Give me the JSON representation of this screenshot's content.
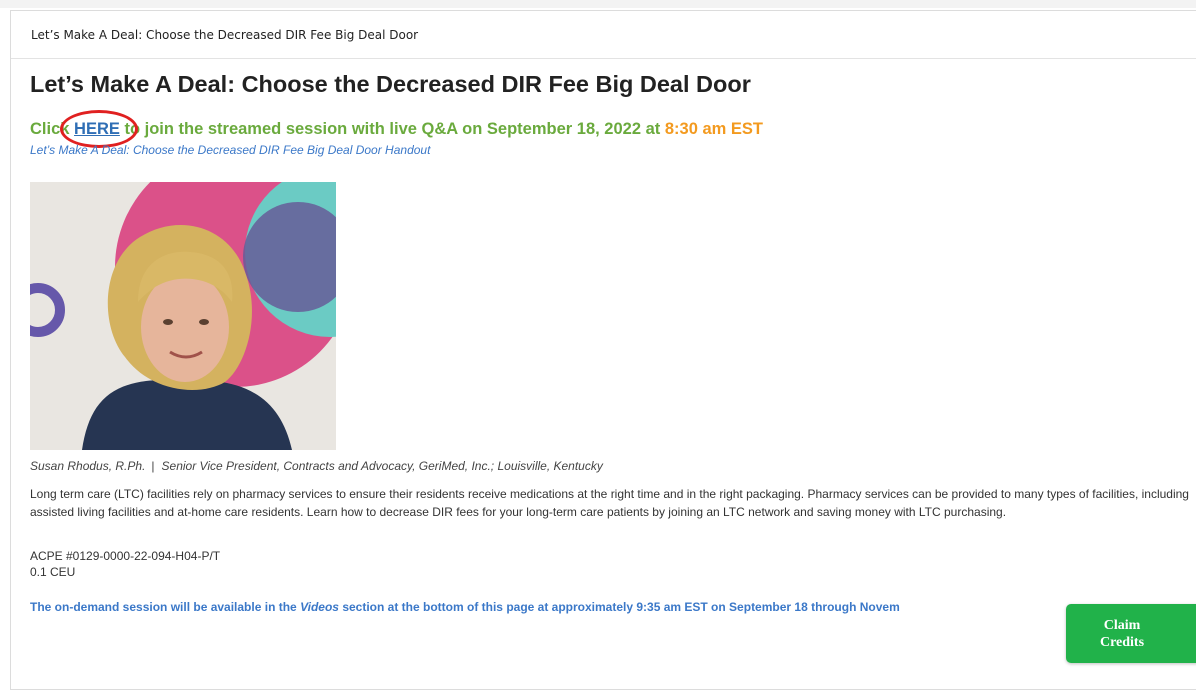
{
  "panel": {
    "header_title": "Let’s Make A Deal: Choose the Decreased DIR Fee Big Deal Door"
  },
  "article": {
    "title": "Let’s Make A Deal: Choose the Decreased DIR Fee Big Deal Door",
    "stream_prefix": "Click ",
    "stream_link": "HERE",
    "stream_middle": " to join the streamed session with live Q&A on September 18, 2022 at ",
    "stream_time": "8:30 am EST",
    "handout_link": "Let’s Make A Deal: Choose the Decreased DIR Fee Big Deal Door Handout",
    "speaker_name": "Susan Rhodus, R.Ph.",
    "caption_separator": "|",
    "speaker_role": "Senior Vice President, Contracts and Advocacy, GeriMed, Inc.; Louisville, Kentucky",
    "description": "Long term care (LTC) facilities rely on pharmacy services to ensure their residents receive medications at the right time and in the right packaging. Pharmacy services can be provided to many types of facilities, including assisted living facilities and at-home care residents. Learn how to decrease DIR fees for your long-term care patients by joining an LTC network and saving money with LTC purchasing.",
    "acpe": "ACPE #0129-0000-22-094-H04-P/T",
    "ceu": "0.1 CEU",
    "ondemand_prefix": "The on-demand session will be available in the ",
    "ondemand_videos": "Videos",
    "ondemand_suffix": " section at the bottom of this page at approximately 9:35 am EST on September 18 through Novem"
  },
  "claim_button": {
    "label": "Claim Credits"
  },
  "colors": {
    "green_text": "#6aaa3d",
    "link_blue": "#2f6eb5",
    "orange_time": "#f39a1f",
    "annotation_red": "#e02020",
    "claim_green": "#21b24a"
  },
  "icons": {
    "annotation": "red-circle-annotation"
  }
}
